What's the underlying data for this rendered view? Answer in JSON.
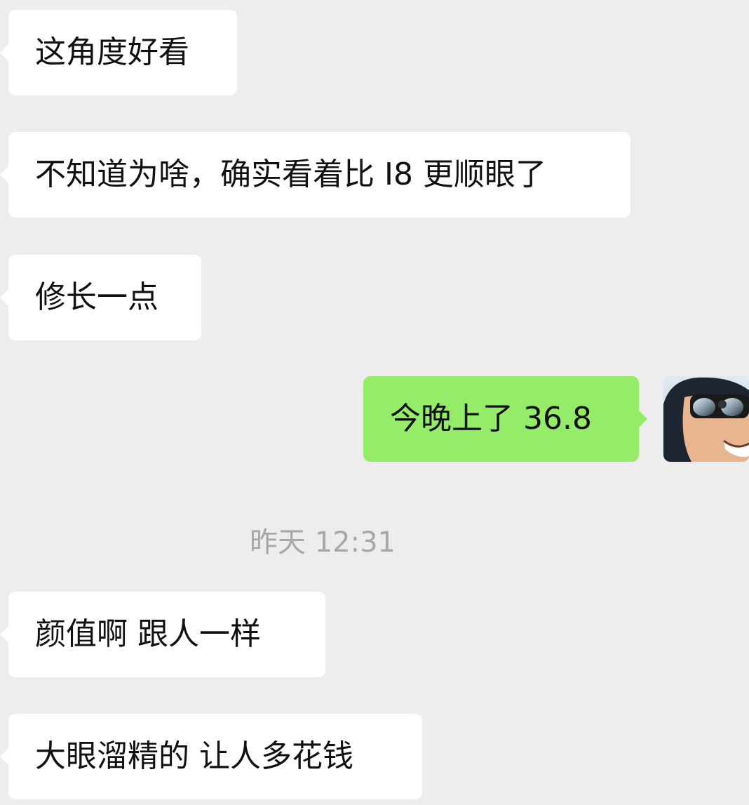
{
  "messages": [
    {
      "direction": "incoming",
      "text": "这角度好看"
    },
    {
      "direction": "incoming",
      "text": "不知道为啥，确实看着比 I8 更顺眼了"
    },
    {
      "direction": "incoming",
      "text": "修长一点"
    },
    {
      "direction": "outgoing",
      "text": "今晚上了 36.8"
    },
    {
      "direction": "incoming",
      "text": "颜值啊 跟人一样"
    },
    {
      "direction": "incoming",
      "text": "大眼溜精的 让人多花钱"
    }
  ],
  "timestamp": "昨天 12:31",
  "colors": {
    "background": "#ededed",
    "incoming_bubble": "#ffffff",
    "outgoing_bubble": "#95ec69",
    "timestamp_text": "#a7a7a7"
  },
  "icons": {
    "sender_avatar": "user-avatar-icon"
  }
}
